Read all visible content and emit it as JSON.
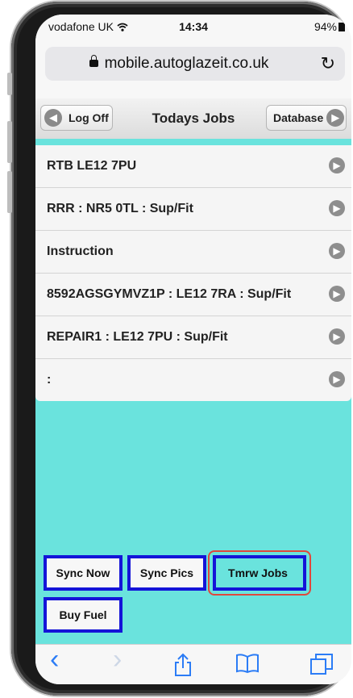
{
  "status": {
    "carrier": "vodafone UK",
    "wifi_icon": "wifi-icon",
    "time": "14:34",
    "battery": "94%"
  },
  "browser": {
    "url": "mobile.autoglazeit.co.uk",
    "reload_icon": "reload-icon"
  },
  "header": {
    "left_button": "Log Off",
    "title": "Todays Jobs",
    "right_button": "Database"
  },
  "jobs": [
    {
      "label": "RTB LE12 7PU"
    },
    {
      "label": "RRR : NR5 0TL : Sup/Fit"
    },
    {
      "label": "Instruction"
    },
    {
      "label": "8592AGSGYMVZ1P : LE12 7RA : Sup/Fit"
    },
    {
      "label": "REPAIR1 : LE12 7PU : Sup/Fit"
    },
    {
      "label": ":"
    }
  ],
  "actions": {
    "sync_now": "Sync Now",
    "sync_pics": "Sync Pics",
    "tmrw_jobs": "Tmrw Jobs",
    "buy_fuel": "Buy Fuel"
  },
  "toolbar": {
    "back": "‹",
    "forward": "›",
    "share": "⇪",
    "bookmarks": "📖",
    "tabs": "❐"
  },
  "colors": {
    "content_bg": "#6ae3dd",
    "button_border": "#1414d8",
    "highlight": "#e0473b",
    "toolbar_accent": "#2b7cf6"
  }
}
